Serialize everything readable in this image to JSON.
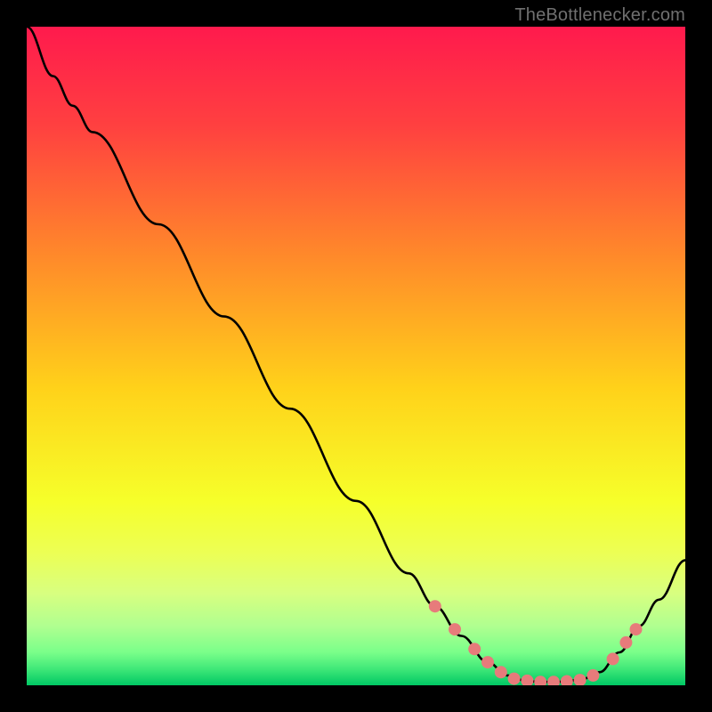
{
  "header": {
    "source_label": "TheBottlenecker.com"
  },
  "chart_data": {
    "type": "line",
    "title": "",
    "xlabel": "",
    "ylabel": "",
    "xlim": [
      0,
      100
    ],
    "ylim": [
      0,
      100
    ],
    "gradient_stops": [
      {
        "offset": 0.0,
        "color": "#ff1a4d"
      },
      {
        "offset": 0.15,
        "color": "#ff4040"
      },
      {
        "offset": 0.35,
        "color": "#ff8a2a"
      },
      {
        "offset": 0.55,
        "color": "#ffd21a"
      },
      {
        "offset": 0.72,
        "color": "#f6ff2a"
      },
      {
        "offset": 0.8,
        "color": "#ecff55"
      },
      {
        "offset": 0.86,
        "color": "#d8ff80"
      },
      {
        "offset": 0.91,
        "color": "#b0ff90"
      },
      {
        "offset": 0.95,
        "color": "#7aff8a"
      },
      {
        "offset": 0.975,
        "color": "#40e878"
      },
      {
        "offset": 1.0,
        "color": "#00c864"
      }
    ],
    "curve": [
      {
        "x": 0.0,
        "y": 100.0
      },
      {
        "x": 4.0,
        "y": 92.5
      },
      {
        "x": 7.0,
        "y": 88.0
      },
      {
        "x": 10.0,
        "y": 84.0
      },
      {
        "x": 20.0,
        "y": 70.0
      },
      {
        "x": 30.0,
        "y": 56.0
      },
      {
        "x": 40.0,
        "y": 42.0
      },
      {
        "x": 50.0,
        "y": 28.0
      },
      {
        "x": 58.0,
        "y": 17.0
      },
      {
        "x": 62.0,
        "y": 12.0
      },
      {
        "x": 66.0,
        "y": 7.5
      },
      {
        "x": 70.0,
        "y": 3.5
      },
      {
        "x": 73.0,
        "y": 1.5
      },
      {
        "x": 76.0,
        "y": 0.6
      },
      {
        "x": 80.0,
        "y": 0.5
      },
      {
        "x": 84.0,
        "y": 0.8
      },
      {
        "x": 87.0,
        "y": 2.0
      },
      {
        "x": 90.0,
        "y": 5.0
      },
      {
        "x": 93.0,
        "y": 9.0
      },
      {
        "x": 96.0,
        "y": 13.0
      },
      {
        "x": 100.0,
        "y": 19.0
      }
    ],
    "marker_color": "#e77b7b",
    "marker_radius_px": 7,
    "markers": [
      {
        "x": 62.0,
        "y": 12.0
      },
      {
        "x": 65.0,
        "y": 8.5
      },
      {
        "x": 68.0,
        "y": 5.5
      },
      {
        "x": 70.0,
        "y": 3.5
      },
      {
        "x": 72.0,
        "y": 2.0
      },
      {
        "x": 74.0,
        "y": 1.0
      },
      {
        "x": 76.0,
        "y": 0.7
      },
      {
        "x": 78.0,
        "y": 0.5
      },
      {
        "x": 80.0,
        "y": 0.5
      },
      {
        "x": 82.0,
        "y": 0.6
      },
      {
        "x": 84.0,
        "y": 0.8
      },
      {
        "x": 86.0,
        "y": 1.5
      },
      {
        "x": 89.0,
        "y": 4.0
      },
      {
        "x": 91.0,
        "y": 6.5
      },
      {
        "x": 92.5,
        "y": 8.5
      }
    ]
  }
}
